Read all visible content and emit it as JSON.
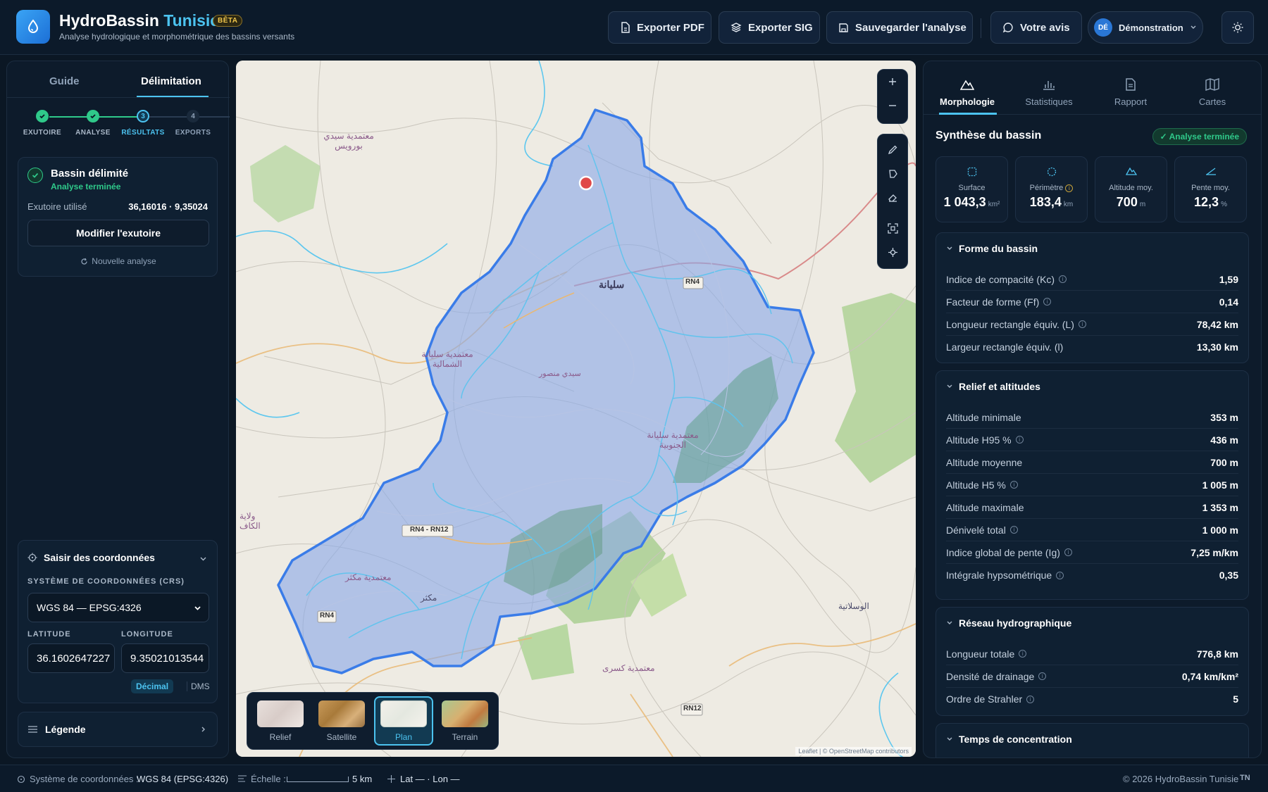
{
  "header": {
    "app_name": "HydroBassin",
    "app_name_accent": "Tunisie",
    "beta": "BÊTA",
    "subtitle": "Analyse hydrologique et morphométrique des bassins versants",
    "buttons": {
      "export_pdf": "Exporter PDF",
      "export_sig": "Exporter SIG",
      "save": "Sauvegarder l'analyse",
      "feedback": "Votre avis"
    },
    "user": {
      "initials": "DÉ",
      "name": "Démonstration"
    }
  },
  "left": {
    "tabs": [
      "Guide",
      "Délimitation"
    ],
    "active_tab": "Délimitation",
    "steps": [
      {
        "label": "EXUTOIRE",
        "state": "done",
        "num": "1"
      },
      {
        "label": "ANALYSE",
        "state": "done",
        "num": "2"
      },
      {
        "label": "RÉSULTATS",
        "state": "active",
        "num": "3"
      },
      {
        "label": "EXPORTS",
        "state": "todo",
        "num": "4"
      }
    ],
    "result_card": {
      "title": "Bassin délimité",
      "status": "Analyse terminée",
      "outlet_label": "Exutoire utilisé",
      "outlet_value": "36,16016 · 9,35024",
      "modify_button": "Modifier l'exutoire",
      "new_analysis": "Nouvelle analyse"
    },
    "coords": {
      "title": "Saisir des coordonnées",
      "crs_label": "SYSTÈME DE COORDONNÉES (CRS)",
      "crs_value": "WGS 84 — EPSG:4326",
      "lat_label": "LATITUDE",
      "lon_label": "LONGITUDE",
      "lat_value": "36.1602647227",
      "lon_value": "9.35021013544",
      "format_decimal": "Décimal",
      "format_dms": "DMS"
    },
    "legend": "Légende"
  },
  "map": {
    "labels": {
      "city": "سليانة",
      "rn4": "RN4",
      "rn4_rn12": "RN4 - RN12",
      "rn4b": "RN4",
      "rn12": "RN12",
      "place1": "معتمدية سيدي بورويس",
      "place2": "معتمدية سليانة الشمالية",
      "place3": "معتمدية سليانة الجنوبية",
      "place4": "معتمدية مكثر",
      "place5": "معتمدية كسرى",
      "place6": "مكثر",
      "place7": "الوسلاتية",
      "place8": "سيدي منصور",
      "place9": "ولاية الكاف"
    },
    "basemaps": [
      "Relief",
      "Satellite",
      "Plan",
      "Terrain"
    ],
    "active_basemap": "Plan",
    "attribution": "Leaflet | © OpenStreetMap contributors"
  },
  "right": {
    "tabs": [
      {
        "label": "Morphologie",
        "icon": "mountain-icon"
      },
      {
        "label": "Statistiques",
        "icon": "bar-chart-icon"
      },
      {
        "label": "Rapport",
        "icon": "document-icon"
      },
      {
        "label": "Cartes",
        "icon": "map-icon"
      }
    ],
    "active_tab": "Morphologie",
    "summary_title": "Synthèse du bassin",
    "summary_badge": "✓ Analyse terminée",
    "stats": [
      {
        "label": "Surface",
        "value": "1 043,3",
        "unit": "km²",
        "icon": "square-icon"
      },
      {
        "label": "Périmètre",
        "value": "183,4",
        "unit": "km",
        "icon": "circle-icon"
      },
      {
        "label": "Altitude moy.",
        "value": "700",
        "unit": "m",
        "icon": "mountain-icon"
      },
      {
        "label": "Pente moy.",
        "value": "12,3",
        "unit": "%",
        "icon": "slope-icon"
      }
    ],
    "shape": {
      "title": "Forme du bassin",
      "rows": [
        {
          "k": "Indice de compacité (Kc)",
          "v": "1,59",
          "info": true
        },
        {
          "k": "Facteur de forme (Ff)",
          "v": "0,14",
          "info": true
        },
        {
          "k": "Longueur rectangle équiv. (L)",
          "v": "78,42 km",
          "info": true
        },
        {
          "k": "Largeur rectangle équiv. (l)",
          "v": "13,30 km",
          "info": false
        }
      ]
    },
    "relief": {
      "title": "Relief et altitudes",
      "rows": [
        {
          "k": "Altitude minimale",
          "v": "353 m",
          "info": false
        },
        {
          "k": "Altitude H95 %",
          "v": "436 m",
          "info": true
        },
        {
          "k": "Altitude moyenne",
          "v": "700 m",
          "info": false
        },
        {
          "k": "Altitude H5 %",
          "v": "1 005 m",
          "info": true
        },
        {
          "k": "Altitude maximale",
          "v": "1 353 m",
          "info": false
        },
        {
          "k": "Dénivelé total",
          "v": "1 000 m",
          "info": true
        },
        {
          "k": "Indice global de pente (Ig)",
          "v": "7,25 m/km",
          "info": true
        },
        {
          "k": "Intégrale hypsométrique",
          "v": "0,35",
          "info": true
        }
      ]
    },
    "network": {
      "title": "Réseau hydrographique",
      "rows": [
        {
          "k": "Longueur totale",
          "v": "776,8 km",
          "info": true
        },
        {
          "k": "Densité de drainage",
          "v": "0,74 km/km²",
          "info": true
        },
        {
          "k": "Ordre de Strahler",
          "v": "5",
          "info": true
        }
      ]
    },
    "concentration": {
      "title": "Temps de concentration"
    }
  },
  "footer": {
    "crs_label": "Système de coordonnées :",
    "crs_value": "WGS 84 (EPSG:4326)",
    "scale_label": "Échelle :",
    "scale_value": "5 km",
    "latlon": "Lat — · Lon —",
    "copyright": "© 2026 HydroBassin Tunisie",
    "lang": "TN"
  }
}
